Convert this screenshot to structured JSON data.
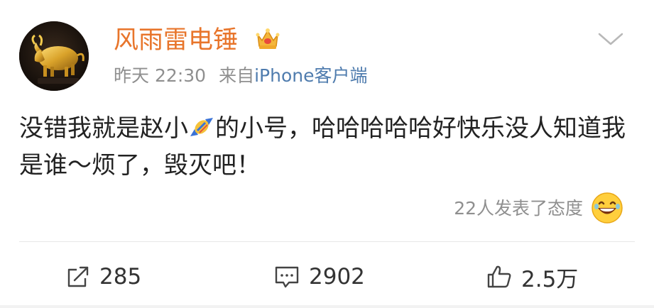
{
  "post": {
    "username": "风雨雷电锤",
    "time_prefix": "昨天",
    "time": "22:30",
    "source_prefix": "来自",
    "source": "iPhone客户端",
    "content_part1": "没错我就是赵小",
    "content_part2": "的小号，哈哈哈哈哈好快乐没人知道我是谁～烦了，毁灭吧！",
    "reactions_text": "22人发表了态度"
  },
  "actions": {
    "share_count": "285",
    "comment_count": "2902",
    "like_count": "2.5万"
  },
  "colors": {
    "username": "#e8752b",
    "link": "#4f7cae",
    "meta": "#8f8f8f",
    "text": "#222222"
  },
  "icons": {
    "crown": "crown-icon",
    "chevron": "chevron-down-icon",
    "candy": "candy-icon",
    "laugh": "laughing-emoji-icon",
    "share": "share-icon",
    "comment": "comment-icon",
    "like": "thumbs-up-icon"
  }
}
